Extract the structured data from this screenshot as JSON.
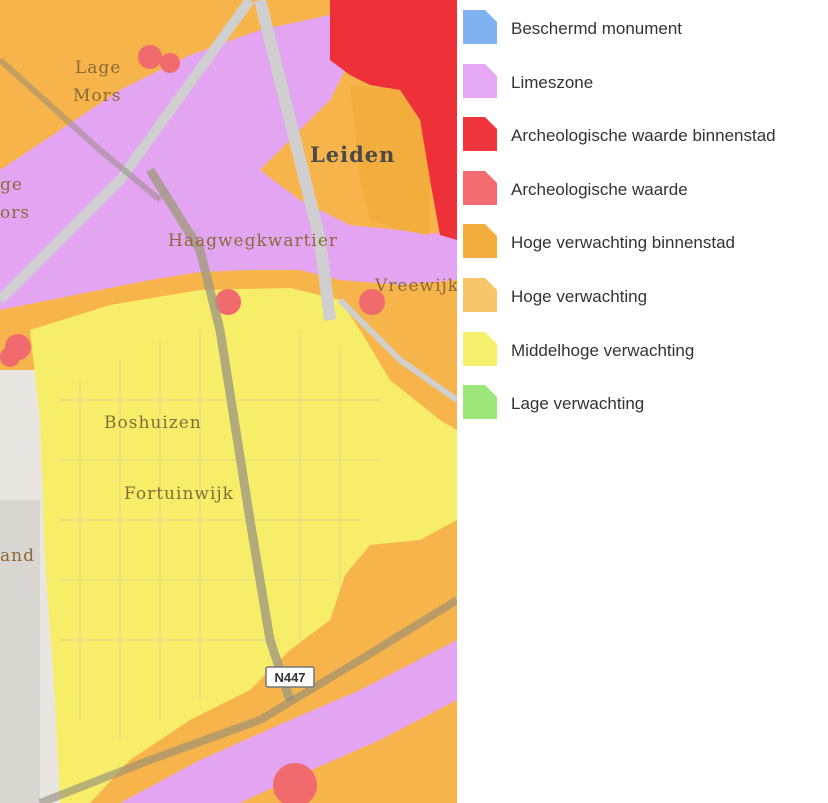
{
  "map": {
    "place_labels": [
      {
        "id": "lage-mors-1",
        "text": "Lage"
      },
      {
        "id": "lage-mors-2",
        "text": "Mors"
      },
      {
        "id": "left-ge",
        "text": "ge"
      },
      {
        "id": "left-ors",
        "text": "ors"
      },
      {
        "id": "leiden",
        "text": "Leiden"
      },
      {
        "id": "haagwegkwartier",
        "text": "Haagwegkwartier"
      },
      {
        "id": "vreewijk",
        "text": "Vreewijk"
      },
      {
        "id": "boshuizen",
        "text": "Boshuizen"
      },
      {
        "id": "fortuinwijk",
        "text": "Fortuinwijk"
      },
      {
        "id": "left-and",
        "text": "and"
      }
    ],
    "road_shield": "N447"
  },
  "legend": {
    "items": [
      {
        "label": "Beschermd monument",
        "color": "#7fb2f0"
      },
      {
        "label": "Limeszone",
        "color": "#e6a8f5"
      },
      {
        "label": "Archeologische waarde binnenstad",
        "color": "#f0363c"
      },
      {
        "label": "Archeologische waarde",
        "color": "#f56a6e"
      },
      {
        "label": "Hoge verwachting binnenstad",
        "color": "#f3ad3c"
      },
      {
        "label": "Hoge verwachting",
        "color": "#f9c56a"
      },
      {
        "label": "Middelhoge verwachting",
        "color": "#f7f06c"
      },
      {
        "label": "Lage verwachting",
        "color": "#9be77a"
      }
    ]
  }
}
